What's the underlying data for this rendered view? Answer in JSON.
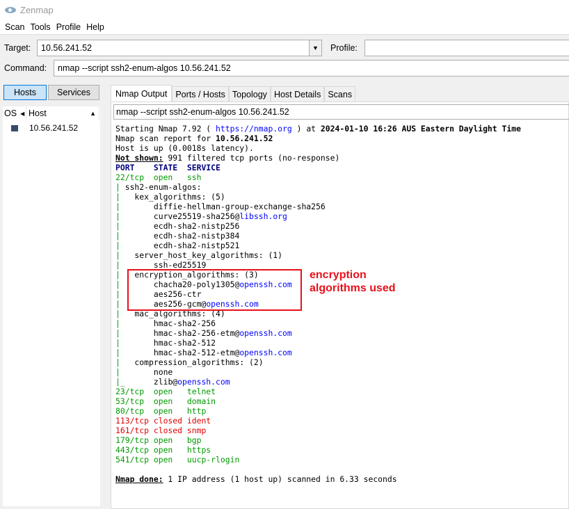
{
  "window": {
    "title": "Zenmap"
  },
  "menu": [
    "Scan",
    "Tools",
    "Profile",
    "Help"
  ],
  "toolbar": {
    "target_label": "Target:",
    "target_value": "10.56.241.52",
    "profile_label": "Profile:",
    "profile_value": "",
    "command_label": "Command:",
    "command_value": "nmap --script ssh2-enum-algos 10.56.241.52"
  },
  "left": {
    "hosts_button": "Hosts",
    "services_button": "Services",
    "col_os": "OS",
    "col_host": "Host",
    "hosts": [
      "10.56.241.52"
    ]
  },
  "tabs": [
    "Nmap Output",
    "Ports / Hosts",
    "Topology",
    "Host Details",
    "Scans"
  ],
  "output": {
    "command": "nmap --script ssh2-enum-algos 10.56.241.52",
    "lines": [
      [
        [
          "Starting Nmap 7.92 ( ",
          ""
        ],
        [
          "https://nmap.org",
          "link"
        ],
        [
          " ) at ",
          ""
        ],
        [
          "2024-01-10 16:26 AUS Eastern Daylight Time",
          "b"
        ]
      ],
      [
        [
          "Nmap scan report for ",
          ""
        ],
        [
          "10.56.241.52",
          "b"
        ]
      ],
      [
        [
          "Host is up (0.0018s latency).",
          ""
        ]
      ],
      [
        [
          "Not shown:",
          "u"
        ],
        [
          " 991 filtered tcp ports (no-response)",
          ""
        ]
      ],
      [
        [
          "PORT    STATE  SERVICE",
          "hdr"
        ]
      ],
      [
        [
          "22/tcp  open   ssh",
          "open"
        ]
      ],
      [
        [
          "|",
          "pipe"
        ],
        [
          " ssh2-enum-algos:",
          ""
        ]
      ],
      [
        [
          "|",
          "pipe"
        ],
        [
          "   kex_algorithms: (5)",
          ""
        ]
      ],
      [
        [
          "|",
          "pipe"
        ],
        [
          "       diffie-hellman-group-exchange-sha256",
          ""
        ]
      ],
      [
        [
          "|",
          "pipe"
        ],
        [
          "       curve25519-sha256@",
          ""
        ],
        [
          "libssh.org",
          "link"
        ]
      ],
      [
        [
          "|",
          "pipe"
        ],
        [
          "       ecdh-sha2-nistp256",
          ""
        ]
      ],
      [
        [
          "|",
          "pipe"
        ],
        [
          "       ecdh-sha2-nistp384",
          ""
        ]
      ],
      [
        [
          "|",
          "pipe"
        ],
        [
          "       ecdh-sha2-nistp521",
          ""
        ]
      ],
      [
        [
          "|",
          "pipe"
        ],
        [
          "   server_host_key_algorithms: (1)",
          ""
        ]
      ],
      [
        [
          "|",
          "pipe"
        ],
        [
          "       ssh-ed25519",
          ""
        ]
      ],
      [
        [
          "|",
          "pipe"
        ],
        [
          "   encryption_algorithms: (3)",
          ""
        ]
      ],
      [
        [
          "|",
          "pipe"
        ],
        [
          "       chacha20-poly1305@",
          ""
        ],
        [
          "openssh.com",
          "link"
        ]
      ],
      [
        [
          "|",
          "pipe"
        ],
        [
          "       aes256-ctr",
          ""
        ]
      ],
      [
        [
          "|",
          "pipe"
        ],
        [
          "       aes256-gcm@",
          ""
        ],
        [
          "openssh.com",
          "link"
        ]
      ],
      [
        [
          "|",
          "pipe"
        ],
        [
          "   mac_algorithms: (4)",
          ""
        ]
      ],
      [
        [
          "|",
          "pipe"
        ],
        [
          "       hmac-sha2-256",
          ""
        ]
      ],
      [
        [
          "|",
          "pipe"
        ],
        [
          "       hmac-sha2-256-etm@",
          ""
        ],
        [
          "openssh.com",
          "link"
        ]
      ],
      [
        [
          "|",
          "pipe"
        ],
        [
          "       hmac-sha2-512",
          ""
        ]
      ],
      [
        [
          "|",
          "pipe"
        ],
        [
          "       hmac-sha2-512-etm@",
          ""
        ],
        [
          "openssh.com",
          "link"
        ]
      ],
      [
        [
          "|",
          "pipe"
        ],
        [
          "   compression_algorithms: (2)",
          ""
        ]
      ],
      [
        [
          "|",
          "pipe"
        ],
        [
          "       none",
          ""
        ]
      ],
      [
        [
          "|_",
          "pipe"
        ],
        [
          "      zlib@",
          ""
        ],
        [
          "openssh.com",
          "link"
        ]
      ],
      [
        [
          "23/tcp  open   telnet",
          "open"
        ]
      ],
      [
        [
          "53/tcp  open   domain",
          "open"
        ]
      ],
      [
        [
          "80/tcp  open   http",
          "open"
        ]
      ],
      [
        [
          "113/tcp closed ident",
          "closed"
        ]
      ],
      [
        [
          "161/tcp closed snmp",
          "closed"
        ]
      ],
      [
        [
          "179/tcp open   bgp",
          "open"
        ]
      ],
      [
        [
          "443/tcp open   https",
          "open"
        ]
      ],
      [
        [
          "541/tcp open   uucp-rlogin",
          "open"
        ]
      ],
      [
        [
          "",
          ""
        ]
      ],
      [
        [
          "Nmap done:",
          "u"
        ],
        [
          " 1 IP address (1 host up) scanned in 6.33 seconds",
          ""
        ]
      ]
    ]
  },
  "annotation": {
    "line1": "encryption",
    "line2": "algorithms used"
  }
}
